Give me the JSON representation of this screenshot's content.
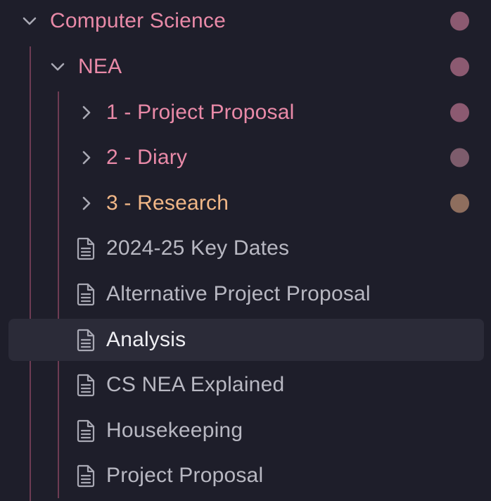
{
  "colors": {
    "background": "#1e1e2a",
    "selected_row": "#2b2b38",
    "folder_pink": "#e98aa8",
    "folder_orange": "#f1b787",
    "file_text": "#b8b8c2",
    "file_text_selected": "#eeeef2",
    "chevron": "#a9a9b4",
    "guide_line": "#6e3c53"
  },
  "tree": {
    "root": {
      "label": "Computer Science",
      "expanded": true,
      "dot_color": "#8c5a71",
      "icon": "chevron-down-icon"
    },
    "nea": {
      "label": "NEA",
      "expanded": true,
      "dot_color": "#8c5a71",
      "icon": "chevron-down-icon"
    },
    "folders": [
      {
        "label": "1 - Project Proposal",
        "expanded": false,
        "dot_color": "#8c5a71",
        "icon": "chevron-right-icon"
      },
      {
        "label": "2 - Diary",
        "expanded": false,
        "dot_color": "#7d5c6c",
        "icon": "chevron-right-icon"
      },
      {
        "label": "3 - Research",
        "expanded": false,
        "dot_color": "#8e6e5e",
        "icon": "chevron-right-icon"
      }
    ],
    "files": [
      {
        "label": "2024-25 Key Dates",
        "selected": false,
        "icon": "document-icon"
      },
      {
        "label": "Alternative Project Proposal",
        "selected": false,
        "icon": "document-icon"
      },
      {
        "label": "Analysis",
        "selected": true,
        "icon": "document-icon"
      },
      {
        "label": "CS NEA Explained",
        "selected": false,
        "icon": "document-icon"
      },
      {
        "label": "Housekeeping",
        "selected": false,
        "icon": "document-icon"
      },
      {
        "label": "Project Proposal",
        "selected": false,
        "icon": "document-icon"
      }
    ]
  }
}
